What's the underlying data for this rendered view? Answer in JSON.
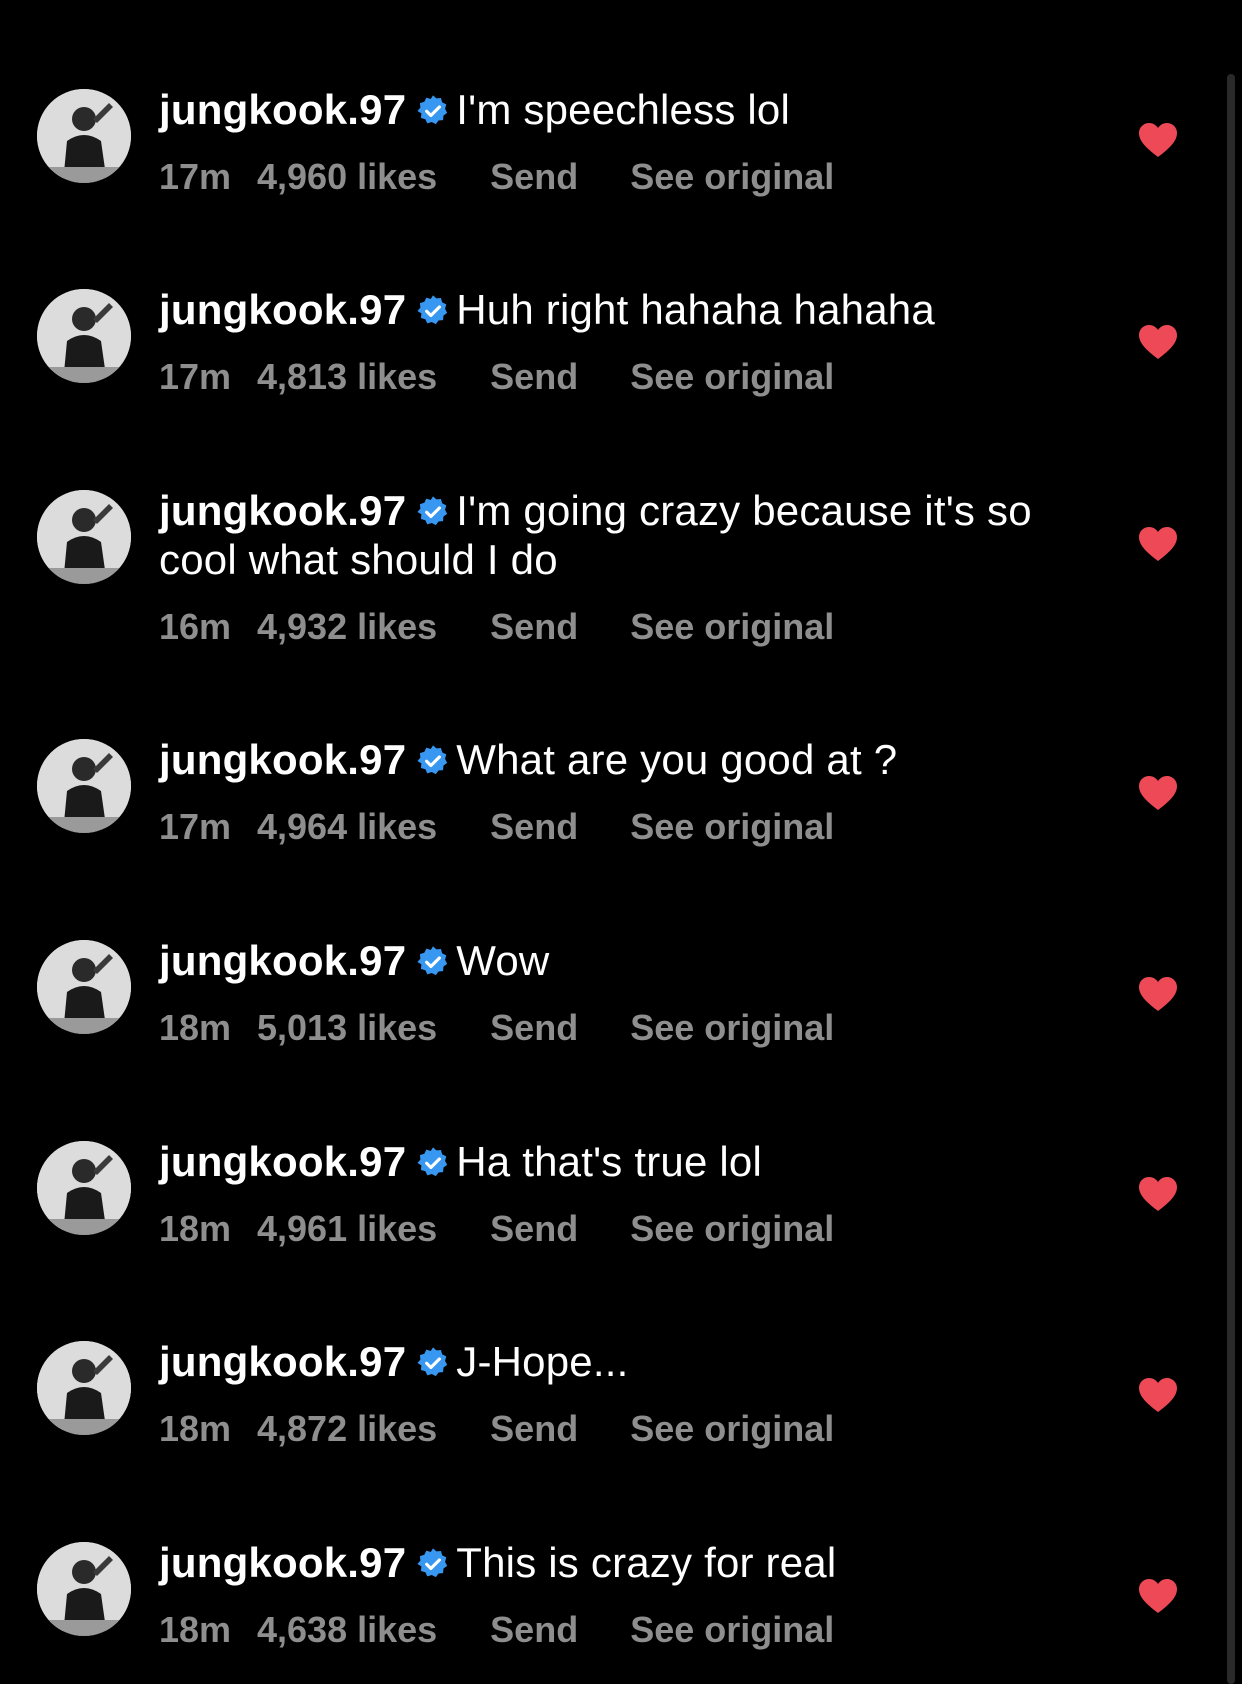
{
  "comments": [
    {
      "username": "jungkook.97",
      "text": "I'm speechless lol",
      "time": "17m",
      "likes": "4,960 likes",
      "send": "Send",
      "see_original": "See original"
    },
    {
      "username": "jungkook.97",
      "text": "Huh right hahaha hahaha",
      "time": "17m",
      "likes": "4,813 likes",
      "send": "Send",
      "see_original": "See original"
    },
    {
      "username": "jungkook.97",
      "text": "I'm going crazy because it's so cool what should I do",
      "time": "16m",
      "likes": "4,932 likes",
      "send": "Send",
      "see_original": "See original"
    },
    {
      "username": "jungkook.97",
      "text": "What are you good at ?",
      "time": "17m",
      "likes": "4,964 likes",
      "send": "Send",
      "see_original": "See original"
    },
    {
      "username": "jungkook.97",
      "text": "Wow",
      "time": "18m",
      "likes": "5,013 likes",
      "send": "Send",
      "see_original": "See original"
    },
    {
      "username": "jungkook.97",
      "text": "Ha that's true lol",
      "time": "18m",
      "likes": "4,961 likes",
      "send": "Send",
      "see_original": "See original"
    },
    {
      "username": "jungkook.97",
      "text": "J-Hope...",
      "time": "18m",
      "likes": "4,872 likes",
      "send": "Send",
      "see_original": "See original"
    },
    {
      "username": "jungkook.97",
      "text": "This is crazy for real",
      "time": "18m",
      "likes": "4,638 likes",
      "send": "Send",
      "see_original": "See original"
    }
  ],
  "colors": {
    "background": "#000000",
    "text": "#ffffff",
    "meta": "#8e8e8e",
    "verified": "#3897f0",
    "heart": "#ed4956"
  },
  "icons": {
    "verified": "verified-badge-icon",
    "like": "heart-filled-icon"
  }
}
